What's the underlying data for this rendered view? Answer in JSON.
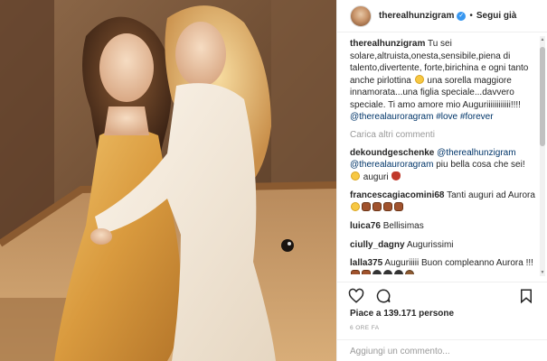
{
  "post": {
    "username": "therealhunzigram",
    "follow_label": "Segui già",
    "dot": "•"
  },
  "caption": {
    "username": "therealhunzigram",
    "text": "Tu sei solare,altruista,onesta,sensibile,piena di talento,divertente, forte,birichina e ogni tanto anche pirlottina",
    "text2": "una sorella maggiore innamorata...una figlia speciale...davvero speciale. Ti amo amore mio Auguriiiiiiiiiiii!!!!",
    "mention": "@therealauroragram",
    "hashtags": "#love #forever"
  },
  "load_more": "Carica altri commenti",
  "comments": [
    {
      "username": "dekoundgeschenke",
      "mention1": "@therealhunzigram",
      "mention2": "@therealauroragram",
      "text": "piu bella cosa che sei!",
      "text2": "auguri"
    },
    {
      "username": "francescagiacomini68",
      "text": "Tanti auguri ad Aurora"
    },
    {
      "username": "luica76",
      "text": "Bellisimas"
    },
    {
      "username": "ciully_dagny",
      "text": "Augurissimi"
    },
    {
      "username": "lalla375",
      "text": "Auguriiiii Buon compleanno Aurora !!!"
    }
  ],
  "icons": {
    "like": "heart-icon",
    "comment": "comment-bubble-icon",
    "save": "bookmark-icon",
    "verified": "verified-badge-icon"
  },
  "likes": "Piace a 139.171 persone",
  "time": "6 ORE FA",
  "add_comment_placeholder": "Aggiungi un commento...",
  "colors": {
    "link": "#003569",
    "verified": "#3897f0",
    "muted": "#999999"
  }
}
